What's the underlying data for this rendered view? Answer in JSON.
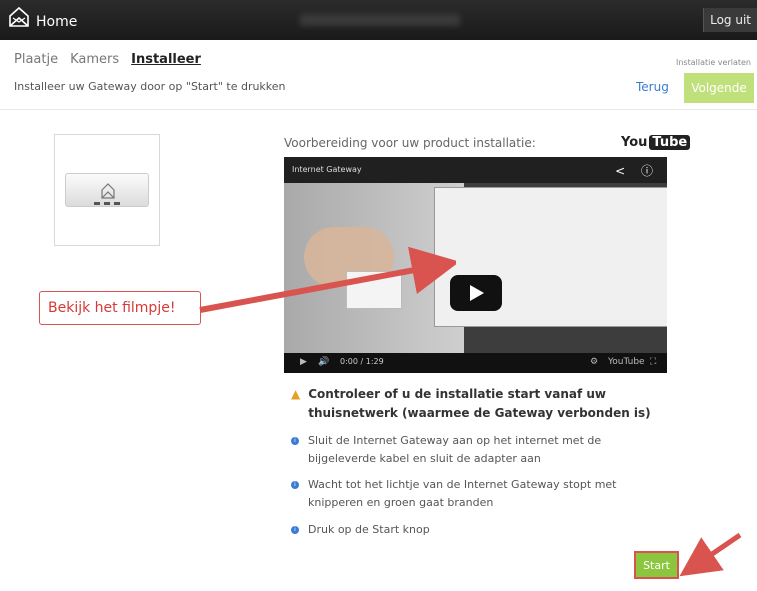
{
  "header": {
    "app_title": "Home",
    "logout_label": "Log uit"
  },
  "subnav": {
    "tabs": [
      {
        "label": "Plaatje"
      },
      {
        "label": "Kamers"
      },
      {
        "label": "Installeer"
      }
    ],
    "leave_label": "Installatie verlaten"
  },
  "toolbar": {
    "instruction": "Installeer uw Gateway door op \"Start\" te drukken",
    "back_label": "Terug",
    "next_label": "Volgende"
  },
  "video": {
    "section_title": "Voorbereiding voor uw product installatie:",
    "youtube_you": "You",
    "youtube_tube": "Tube",
    "player_title": "Internet Gateway",
    "time": "0:00 / 1:29",
    "player_logo": "YouTube"
  },
  "annotation": {
    "callout": "Bekijk het filmpje!"
  },
  "steps": {
    "warning": "Controleer of u de installatie start vanaf uw thuisnetwerk (waarmee de Gateway verbonden is)",
    "items": [
      "Sluit de Internet Gateway aan op het internet met de bijgeleverde kabel en sluit de adapter aan",
      "Wacht tot het lichtje van de Internet Gateway stopt met knipperen en groen gaat branden",
      "Druk op de Start knop"
    ]
  },
  "start_label": "Start",
  "colors": {
    "accent": "#3a7bd5",
    "next": "#bfe07a",
    "start": "#8cc63f",
    "callout": "#d63a36"
  }
}
